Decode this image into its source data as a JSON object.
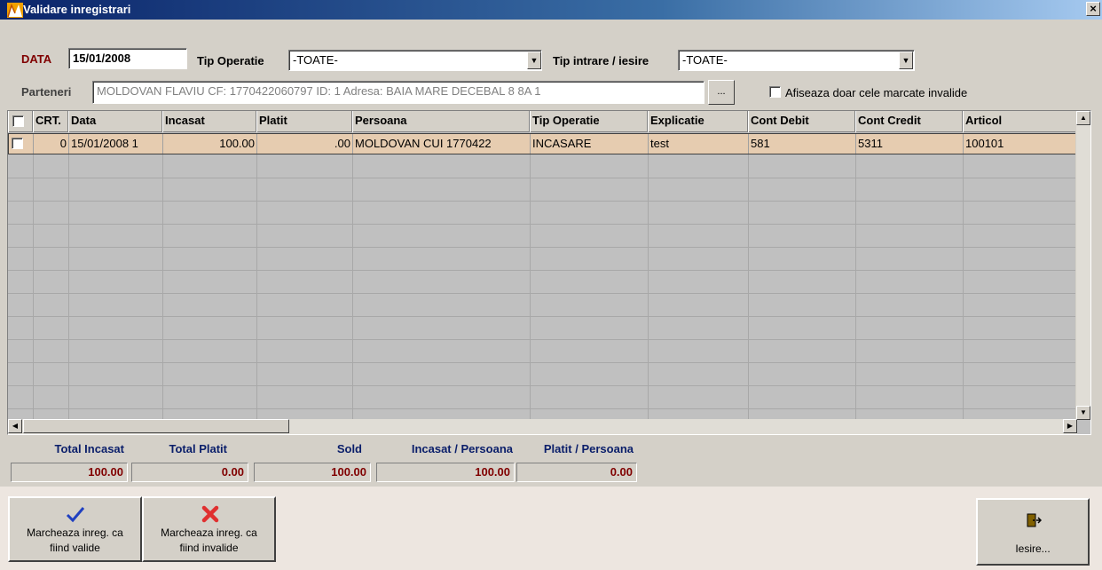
{
  "window": {
    "title": "Validare inregistrari",
    "close_glyph": "×"
  },
  "filters": {
    "data_label": "DATA",
    "data_value": "15/01/2008",
    "tip_operatie_label": "Tip Operatie",
    "tip_operatie_value": "-TOATE-",
    "tip_intrare_label": "Tip intrare / iesire",
    "tip_intrare_value": "-TOATE-",
    "parteneri_label": "Parteneri",
    "parteneri_value": "MOLDOVAN FLAVIU CF: 1770422060797 ID: 1 Adresa:  BAIA MARE DECEBAL 8 8A 1",
    "browse_label": "...",
    "afiseaza_label": "Afiseaza doar cele marcate invalide"
  },
  "grid": {
    "columns": [
      "",
      "CRT.",
      "Data",
      "Incasat",
      "Platit",
      "Persoana",
      "Tip Operatie",
      "Explicatie",
      "Cont Debit",
      "Cont Credit",
      "Articol"
    ],
    "rows": [
      {
        "crt": "0",
        "data": "15/01/2008 1",
        "incasat": "100.00",
        "platit": ".00",
        "persoana": "MOLDOVAN CUI 1770422",
        "tip_operatie": "INCASARE",
        "explicatie": "test",
        "cont_debit": "581",
        "cont_credit": "5311",
        "articol": "100101"
      }
    ]
  },
  "totals": {
    "total_incasat_label": "Total Incasat",
    "total_incasat_value": "100.00",
    "total_platit_label": "Total Platit",
    "total_platit_value": "0.00",
    "sold_label": "Sold",
    "sold_value": "100.00",
    "incasat_persoana_label": "Incasat / Persoana",
    "incasat_persoana_value": "100.00",
    "platit_persoana_label": "Platit / Persoana",
    "platit_persoana_value": "0.00"
  },
  "actions": {
    "valide_line1": "Marcheaza inreg. ca",
    "valide_line2": "fiind valide",
    "invalide_line1": "Marcheaza inreg. ca",
    "invalide_line2": "fiind invalide",
    "iesire_label": "Iesire..."
  },
  "colors": {
    "selected_row": "#e6ccb0",
    "title_bar": "#0a246a",
    "value_red": "#800000"
  }
}
